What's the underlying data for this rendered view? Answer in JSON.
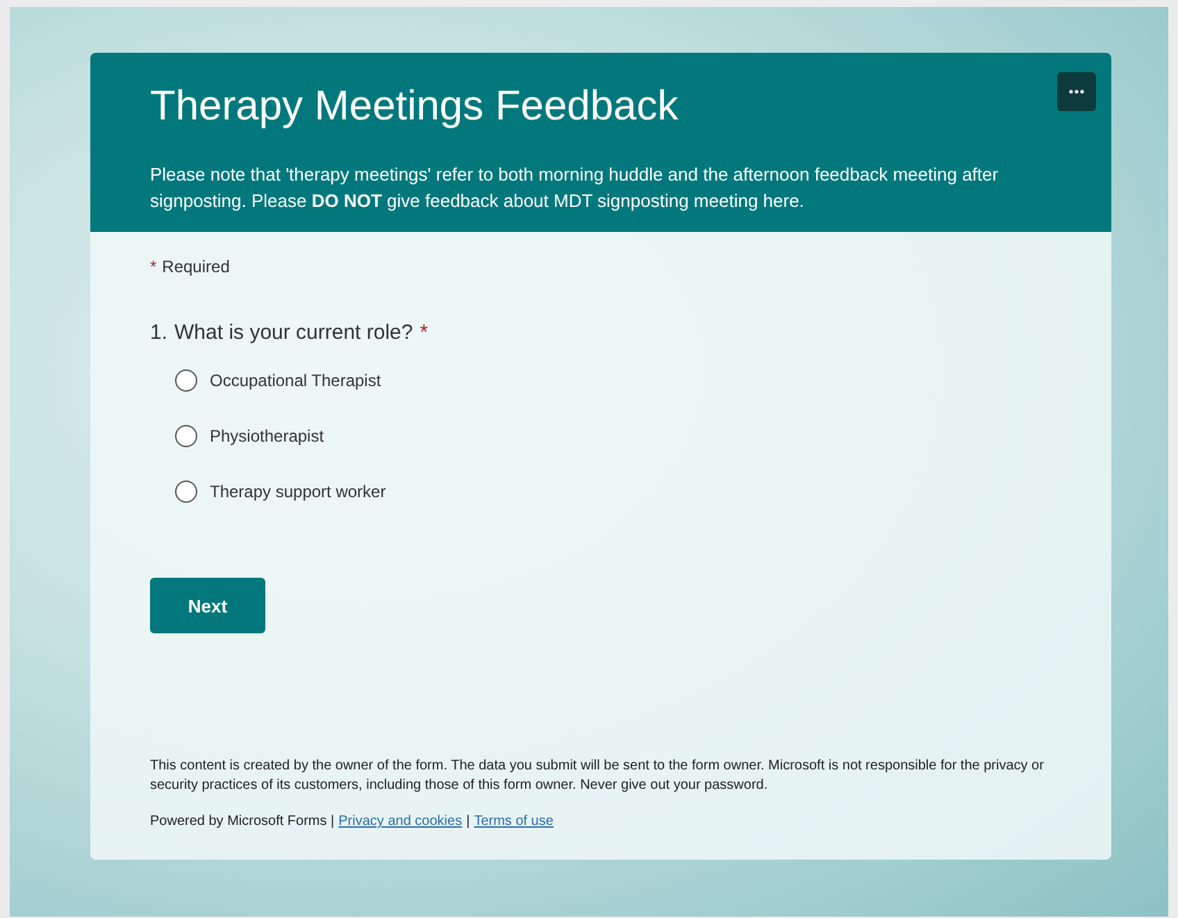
{
  "header": {
    "title": "Therapy Meetings Feedback",
    "description": "Please note that 'therapy meetings' refer to both morning huddle and the afternoon feedback meeting after signposting. Please **DO NOT** give feedback about MDT signposting meeting here."
  },
  "required_note": {
    "mark": "*",
    "label": "Required"
  },
  "question": {
    "number": "1.",
    "text": "What is your current role?",
    "required_mark": "*",
    "options": [
      {
        "label": "Occupational Therapist",
        "selected": false
      },
      {
        "label": "Physiotherapist",
        "selected": false
      },
      {
        "label": "Therapy support worker",
        "selected": false
      }
    ]
  },
  "next_button": "Next",
  "disclaimer": "This content is created by the owner of the form. The data you submit will be sent to the form owner. Microsoft is not responsible for the privacy or security practices of its customers, including those of this form owner. Never give out your password.",
  "footer": {
    "powered_by": "Powered by Microsoft Forms |",
    "links": [
      "Privacy and cookies",
      "Terms of use"
    ],
    "separator": "|"
  }
}
